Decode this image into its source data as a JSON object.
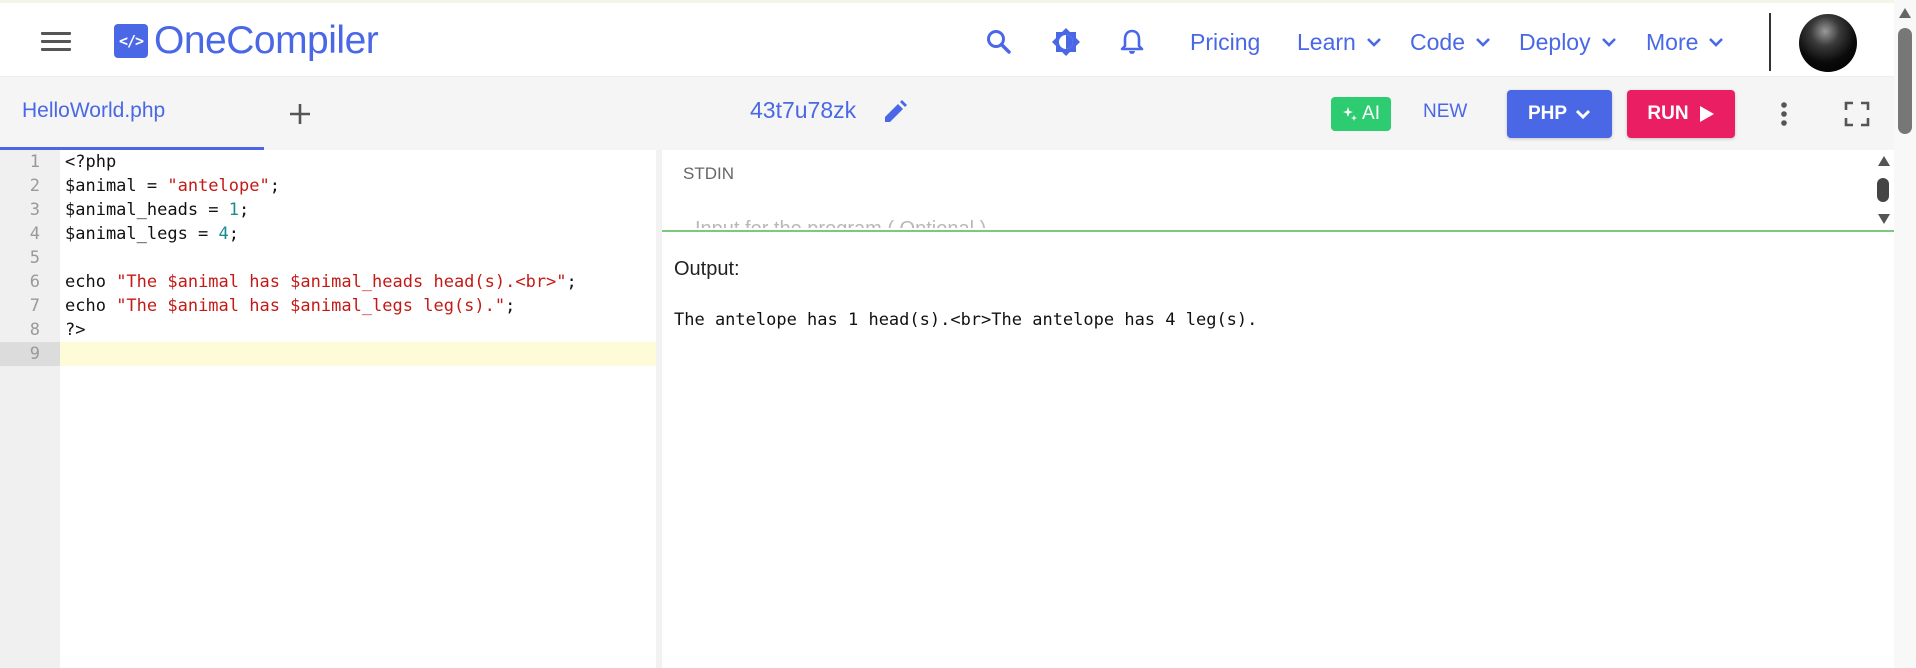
{
  "header": {
    "logo_icon_text": "</>",
    "logo_text": "OneCompiler",
    "icons": [
      "search-icon",
      "theme-toggle-icon",
      "bell-icon"
    ],
    "nav": [
      {
        "label": "Pricing",
        "has_dropdown": false
      },
      {
        "label": "Learn",
        "has_dropdown": true
      },
      {
        "label": "Code",
        "has_dropdown": true
      },
      {
        "label": "Deploy",
        "has_dropdown": true
      },
      {
        "label": "More",
        "has_dropdown": true
      }
    ],
    "accent_color": "#4a68e6"
  },
  "toolbar": {
    "file_tab": "HelloWorld.php",
    "code_id": "43t7u78zk",
    "ai_label": "AI",
    "new_label": "NEW",
    "language_label": "PHP",
    "run_label": "RUN",
    "ai_color": "#2ecc71",
    "run_color": "#e91e63"
  },
  "editor": {
    "active_line": 9,
    "lines": [
      {
        "n": "1",
        "code": "<?php"
      },
      {
        "n": "2",
        "code": "$animal = \"antelope\";"
      },
      {
        "n": "3",
        "code": "$animal_heads = 1;"
      },
      {
        "n": "4",
        "code": "$animal_legs = 4;"
      },
      {
        "n": "5",
        "code": ""
      },
      {
        "n": "6",
        "code": "echo \"The $animal has $animal_heads head(s).<br>\";"
      },
      {
        "n": "7",
        "code": "echo \"The $animal has $animal_legs leg(s).\";"
      },
      {
        "n": "8",
        "code": "?>"
      },
      {
        "n": "9",
        "code": ""
      }
    ]
  },
  "io": {
    "stdin_label": "STDIN",
    "stdin_placeholder": "Input for the program ( Optional )",
    "output_label": "Output:",
    "output_text": "The antelope has 1 head(s).<br>The antelope has 4 leg(s)."
  }
}
